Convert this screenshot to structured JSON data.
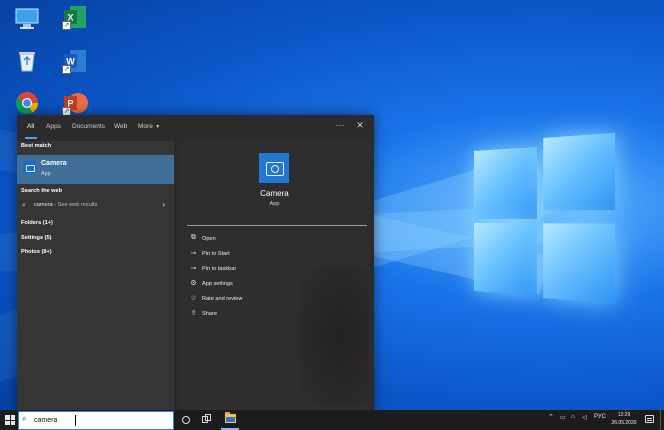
{
  "desktop": {
    "icons": [
      {
        "name": "this-pc-icon"
      },
      {
        "name": "excel-icon"
      },
      {
        "name": "recycle-bin-icon"
      },
      {
        "name": "word-icon"
      },
      {
        "name": "chrome-icon"
      },
      {
        "name": "powerpoint-icon"
      }
    ]
  },
  "search_panel": {
    "tabs": [
      {
        "label": "All"
      },
      {
        "label": "Apps"
      },
      {
        "label": "Documents"
      },
      {
        "label": "Web"
      },
      {
        "label": "More"
      }
    ],
    "more_options": "···",
    "close": "✕",
    "best_match": {
      "section_title": "Best match",
      "name": "Camera",
      "type": "App"
    },
    "web": {
      "section_title": "Search the web",
      "query": "camera",
      "suffix": " - See web results"
    },
    "categories": [
      {
        "label": "Folders (1+)"
      },
      {
        "label": "Settings (5)"
      },
      {
        "label": "Photos (8+)"
      }
    ],
    "detail": {
      "title": "Camera",
      "subtitle": "App",
      "actions": [
        {
          "label": "Open",
          "icon": "open-icon"
        },
        {
          "label": "Pin to Start",
          "icon": "pin-icon"
        },
        {
          "label": "Pin to taskbar",
          "icon": "pin-icon"
        },
        {
          "label": "App settings",
          "icon": "gear-icon"
        },
        {
          "label": "Rate and review",
          "icon": "star-icon"
        },
        {
          "label": "Share",
          "icon": "share-icon"
        }
      ]
    }
  },
  "taskbar": {
    "search_value": "camera",
    "language": "РУС",
    "time": "12:29",
    "date": "26.05.2020"
  },
  "colors": {
    "panel_bg": "#2b2b2b",
    "best_match_highlight": "#3f6e98",
    "accent": "#4aa3f0",
    "taskbar_bg": "#1c1c1c"
  }
}
